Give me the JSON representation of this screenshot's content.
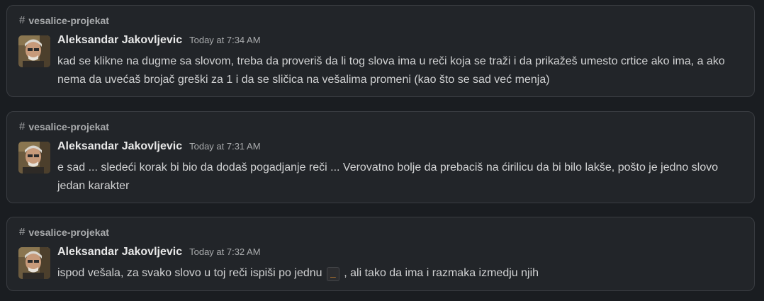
{
  "messages": [
    {
      "channel": "vesalice-projekat",
      "author": "Aleksandar Jakovljevic",
      "time": "Today at 7:34 AM",
      "text": "kad se klikne na dugme sa slovom, treba da proveriš da li tog slova ima u reči koja se traži i da prikažeš umesto crtice ako ima, a ako nema da uvećaš brojač greški za 1 i da se sličica na vešalima promeni (kao što se sad već menja)"
    },
    {
      "channel": "vesalice-projekat",
      "author": "Aleksandar Jakovljevic",
      "time": "Today at 7:31 AM",
      "text": "e sad ... sledeći korak bi bio da dodaš pogadjanje reči ... Verovatno bolje da prebaciš na ćirilicu da bi bilo lakše, pošto je jedno slovo jedan karakter"
    },
    {
      "channel": "vesalice-projekat",
      "author": "Aleksandar Jakovljevic",
      "time": "Today at 7:32 AM",
      "text_before": "ispod vešala, za svako slovo u toj reči ispiši po jednu",
      "code": "_",
      "text_after": ", ali tako da ima i razmaka izmedju njih"
    }
  ],
  "icons": {
    "channel": "hash-icon",
    "avatar": "user-avatar"
  },
  "colors": {
    "background": "#1a1d21",
    "card": "#222529",
    "border": "#3a3d42",
    "code_text": "#e8912d"
  }
}
